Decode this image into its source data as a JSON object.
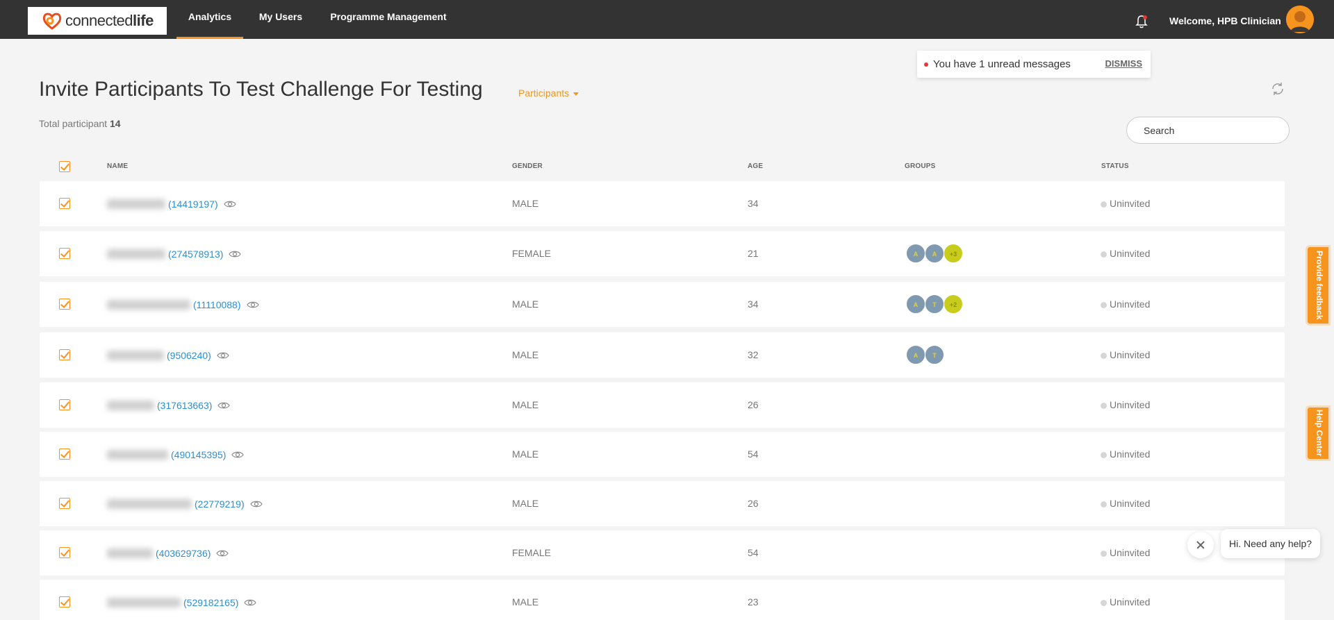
{
  "nav": {
    "logo_text_1": "connected",
    "logo_text_2": "life",
    "tabs": [
      "Analytics",
      "My Users",
      "Programme Management"
    ],
    "welcome": "Welcome, HPB Clinician"
  },
  "notification": {
    "text": "You have 1 unread messages",
    "dismiss": "DISMISS"
  },
  "page": {
    "title": "Invite Participants To Test Challenge For Testing",
    "filter_label": "Participants",
    "total_label": "Total participant",
    "total_count": "14",
    "search_placeholder": "Search"
  },
  "table": {
    "headers": {
      "name": "NAME",
      "gender": "GENDER",
      "age": "AGE",
      "groups": "GROUPS",
      "status": "STATUS"
    },
    "rows": [
      {
        "id": "(14419197)",
        "gender": "MALE",
        "age": "34",
        "groups": [],
        "status": "Uninvited"
      },
      {
        "id": "(274578913)",
        "gender": "FEMALE",
        "age": "21",
        "groups": [
          {
            "label": "A",
            "color": "blue"
          },
          {
            "label": "A",
            "color": "blue"
          },
          {
            "label": "+3",
            "color": "yellow"
          }
        ],
        "status": "Uninvited"
      },
      {
        "id": "(11110088)",
        "gender": "MALE",
        "age": "34",
        "groups": [
          {
            "label": "A",
            "color": "blue"
          },
          {
            "label": "T",
            "color": "blue"
          },
          {
            "label": "+2",
            "color": "yellow"
          }
        ],
        "status": "Uninvited"
      },
      {
        "id": "(9506240)",
        "gender": "MALE",
        "age": "32",
        "groups": [
          {
            "label": "A",
            "color": "blue"
          },
          {
            "label": "T",
            "color": "blue"
          }
        ],
        "status": "Uninvited"
      },
      {
        "id": "(317613663)",
        "gender": "MALE",
        "age": "26",
        "groups": [],
        "status": "Uninvited"
      },
      {
        "id": "(490145395)",
        "gender": "MALE",
        "age": "54",
        "groups": [],
        "status": "Uninvited"
      },
      {
        "id": "(22779219)",
        "gender": "MALE",
        "age": "26",
        "groups": [],
        "status": "Uninvited"
      },
      {
        "id": "(403629736)",
        "gender": "FEMALE",
        "age": "54",
        "groups": [],
        "status": "Uninvited"
      },
      {
        "id": "(529182165)",
        "gender": "MALE",
        "age": "23",
        "groups": [],
        "status": "Uninvited"
      }
    ]
  },
  "side_tabs": {
    "feedback": "Provide feedback",
    "help": "Help Center"
  },
  "chat": {
    "text": "Hi. Need any help?"
  },
  "colors": {
    "accent": "#f7941d",
    "nav_bg": "#333333",
    "link": "#2a8fd8"
  }
}
